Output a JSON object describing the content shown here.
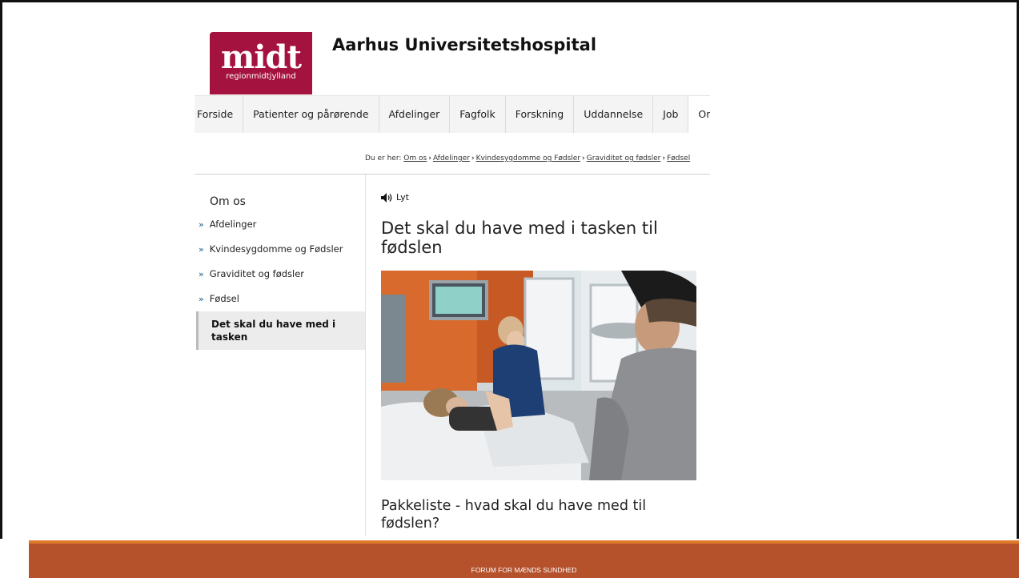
{
  "logo": {
    "main": "midt",
    "sub": "regionmidtjylland"
  },
  "site_title": "Aarhus Universitetshospital",
  "nav": [
    "Forside",
    "Patienter og pårørende",
    "Afdelinger",
    "Fagfolk",
    "Forskning",
    "Uddannelse",
    "Job",
    "Om os"
  ],
  "breadcrumb": {
    "prefix": "Du er her:",
    "links": [
      "Om os",
      "Afdelinger",
      "Kvindesygdomme og Fødsler",
      "Graviditet og fødsler",
      "Fødsel"
    ]
  },
  "sidebar": {
    "heading": "Om os",
    "items": [
      "Afdelinger",
      "Kvindesygdomme og Fødsler",
      "Graviditet og fødsler",
      "Fødsel"
    ],
    "active": "Det skal du have med i tasken"
  },
  "listen_label": "Lyt",
  "article": {
    "title": "Det skal du have med i tasken til fødslen",
    "subheading": "Pakkeliste - hvad skal du have med til fødslen?"
  },
  "footer_text": "FORUM FOR MÆNDS SUNDHED",
  "colors": {
    "brand": "#a4123f",
    "footer": "#b5522c",
    "footer_accent": "#e07a2a"
  }
}
